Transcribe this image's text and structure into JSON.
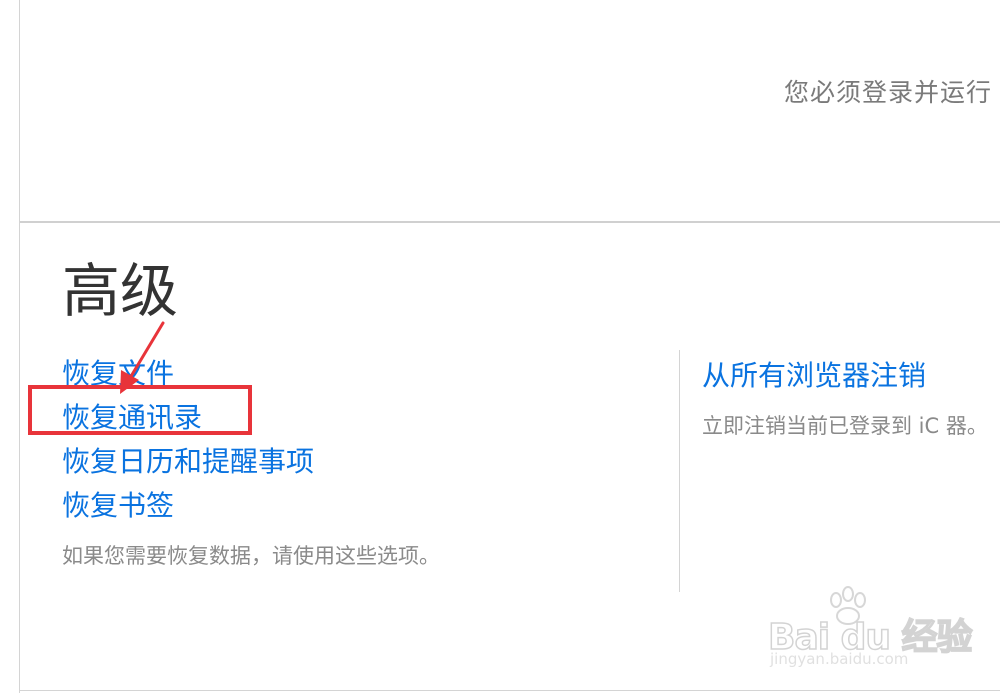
{
  "top_section": {
    "message": "您必须登录并运行"
  },
  "advanced": {
    "title": "高级",
    "links": [
      {
        "label": "恢复文件"
      },
      {
        "label": "恢复通讯录"
      },
      {
        "label": "恢复日历和提醒事项"
      },
      {
        "label": "恢复书签"
      }
    ],
    "hint": "如果您需要恢复数据，请使用这些选项。"
  },
  "signout": {
    "link": "从所有浏览器注销",
    "description": "立即注销当前已登录到 iC 器。"
  },
  "annotation": {
    "highlight_color": "#e8343a",
    "highlighted_item": "恢复通讯录"
  },
  "colors": {
    "link": "#0a73e0",
    "muted_text": "#8a8a8a",
    "heading": "#333333",
    "divider": "#d0d0d0"
  },
  "watermark": {
    "logo": "Bai du 经验",
    "url": "jingyan.baidu.com"
  }
}
